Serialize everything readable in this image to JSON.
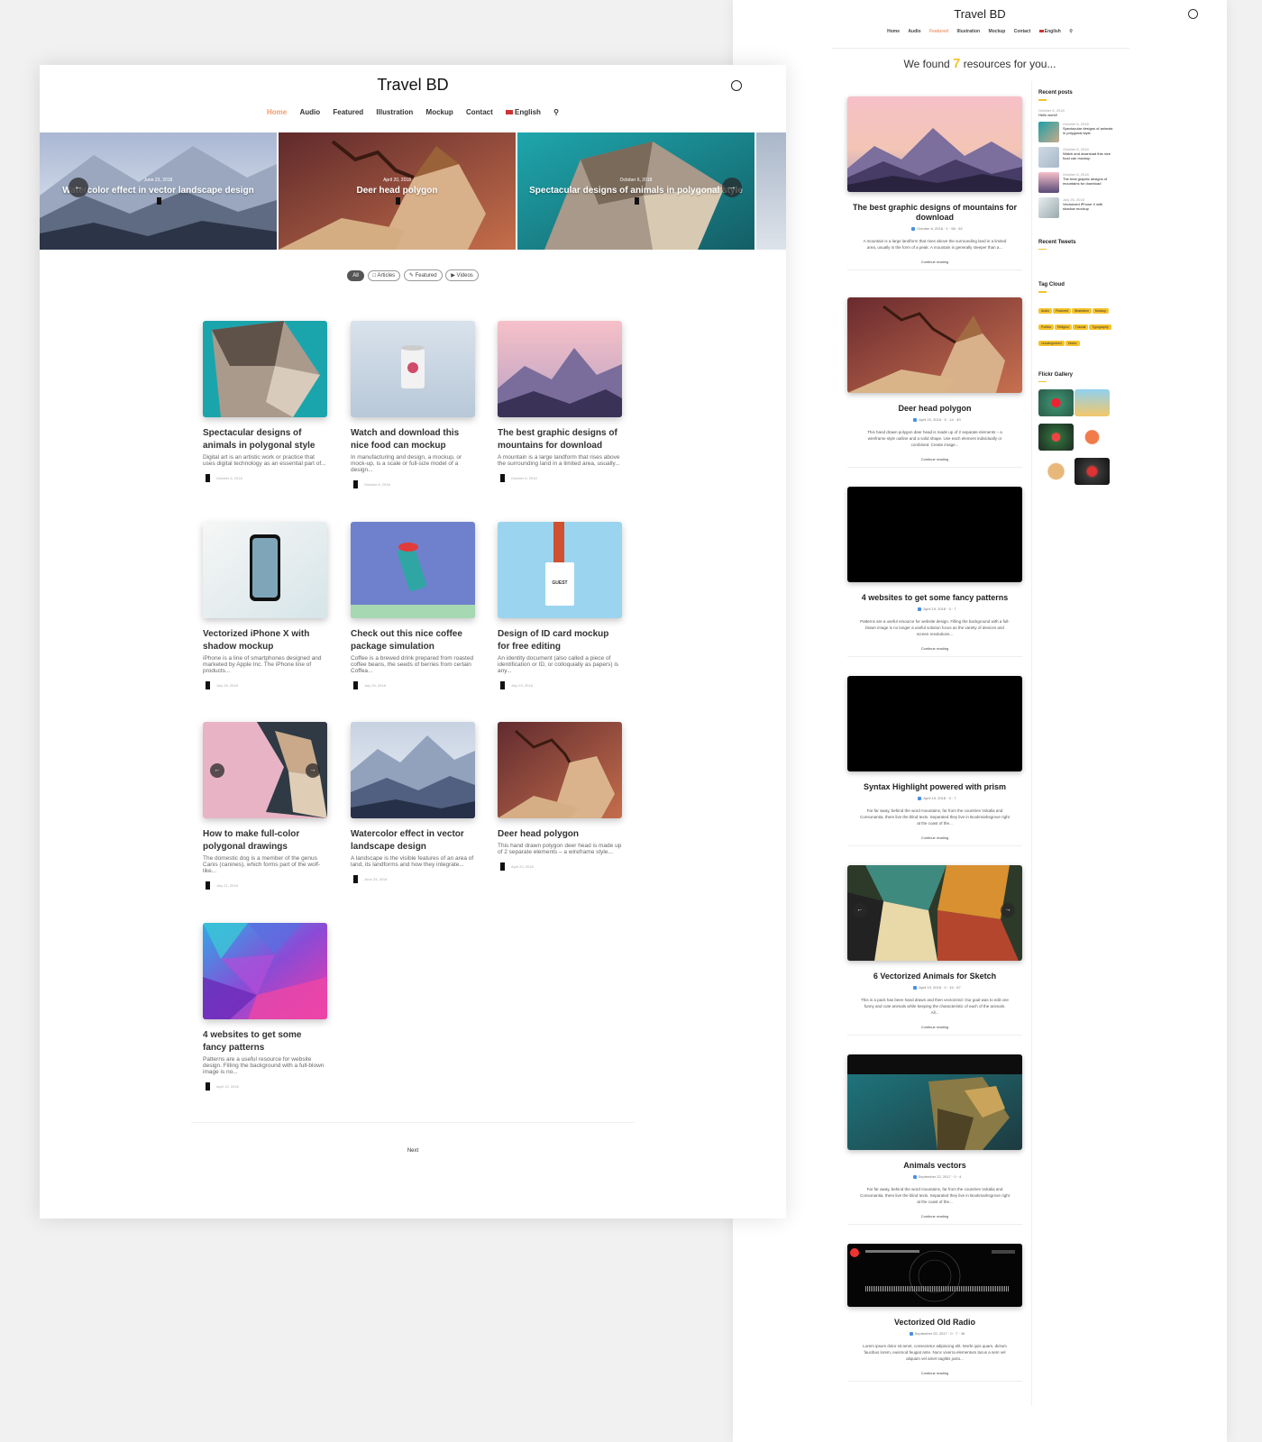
{
  "home": {
    "brand": "Travel BD",
    "nav": [
      "Home",
      "Audio",
      "Featured",
      "Illustration",
      "Mockup",
      "Contact",
      "English"
    ],
    "slides": [
      {
        "date": "June 23, 2018",
        "title": "Watercolor effect in vector landscape design"
      },
      {
        "date": "April 20, 2018",
        "title": "Deer head polygon"
      },
      {
        "date": "October 6, 2018",
        "title": "Spectacular designs of animals in polygonal style"
      }
    ],
    "filters": [
      "All",
      "Articles",
      "Featured",
      "Videos"
    ],
    "posts": [
      {
        "title": "Spectacular designs of animals in polygonal style",
        "excerpt": "Digital art is an artistic work or practice that uses digital technology as an essential part of...",
        "date": "October 6, 2018"
      },
      {
        "title": "Watch and download this nice food can mockup",
        "excerpt": "In manufacturing and design, a mockup, or mock-up, is a scale or full-size model of a design...",
        "date": "October 6, 2018"
      },
      {
        "title": "The best graphic designs of mountains for download",
        "excerpt": "A mountain is a large landform that rises above the surrounding land in a limited area, usually...",
        "date": "October 6, 2018"
      },
      {
        "title": "Vectorized iPhone X with shadow mockup",
        "excerpt": "iPhone is a line of smartphones designed and marketed by Apple Inc. The iPhone line of products...",
        "date": "July 26, 2018"
      },
      {
        "title": "Check out this nice coffee package simulation",
        "excerpt": "Coffee is a brewed drink prepared from roasted coffee beans, the seeds of berries from certain Coffea...",
        "date": "July 26, 2018"
      },
      {
        "title": "Design of ID card mockup for free editing",
        "excerpt": "An identity document (also called a piece of identification or ID, or colloquially as papers) is any...",
        "date": "July 23, 2018"
      },
      {
        "title": "How to make full-color polygonal drawings",
        "excerpt": "The domestic dog is a member of the genus Canis (canines), which forms part of the wolf-like...",
        "date": "July 21, 2018"
      },
      {
        "title": "Watercolor effect in vector landscape design",
        "excerpt": "A landscape is the visible features of an area of land, its landforms and how they integrate...",
        "date": "June 23, 2018"
      },
      {
        "title": "Deer head polygon",
        "excerpt": "This hand drawn polygon deer head is made up of 2 separate elements – a wireframe style...",
        "date": "April 20, 2018"
      },
      {
        "title": "4 websites to get some fancy patterns",
        "excerpt": "Patterns are a useful resource for website design. Filling the background with a full-blown image is no...",
        "date": "April 19, 2018"
      }
    ],
    "pagination_next": "Next",
    "badge_text": "GUEST"
  },
  "featured": {
    "brand": "Travel BD",
    "nav": [
      "Home",
      "Audio",
      "Featured",
      "Illustration",
      "Mockup",
      "Contact",
      "English"
    ],
    "found": {
      "prefix": "We found",
      "count": "7",
      "suffix": "resources for you..."
    },
    "posts": [
      {
        "title": "The best graphic designs of mountains for download",
        "meta": "October 6, 2018 · 1 · 98 · 62",
        "excerpt": "A mountain is a large landform that rises above the surrounding land in a limited area, usually in the form of a peak. A mountain is generally steeper than a...",
        "more": "Continue reading"
      },
      {
        "title": "Deer head polygon",
        "meta": "April 20, 2018 · 5 · 14 · 40",
        "excerpt": "This hand drawn polygon deer head is made up of 2 separate elements – a wireframe style outline and a solid shape. Use each element individually or combined. Create image...",
        "more": "Continue reading"
      },
      {
        "title": "4 websites to get some fancy patterns",
        "meta": "April 19, 2018 · 0 · 7",
        "excerpt": "Patterns are a useful resource for website design. Filling the background with a full-blown image is no longer a useful solution focus as the variety of devices and screen resolutions...",
        "more": "Continue reading"
      },
      {
        "title": "Syntax Highlight powered with prism",
        "meta": "April 19, 2018 · 0 · 7",
        "excerpt": "Far far away, behind the word mountains, far from the countries Vokalia and Consonantia, there live the blind texts. Separated they live in Bookmarksgrove right at the coast of the...",
        "more": "Continue reading"
      },
      {
        "title": "6 Vectorized Animals for Sketch",
        "meta": "April 19, 2018 · 0 · 15 · 67",
        "excerpt": "This is a pack has been hand drawn and then vectorized. Our goal was to edit one funny and cute animals while keeping the characteristic of each of the animals. All...",
        "more": "Continue reading"
      },
      {
        "title": "Animals vectors",
        "meta": "September 22, 2017 · 0 · 4",
        "excerpt": "Far far away, behind the word mountains, far from the countries Vokalia and Consonantia, there live the blind texts. Separated they live in Bookmarksgrove right at the coast of the...",
        "more": "Continue reading"
      },
      {
        "title": "Vectorized Old Radio",
        "meta": "September 20, 2017 · 0 · 7 · 36",
        "excerpt": "Lorem ipsum dolor sit amet, consectetur adipiscing elit. Morbi quis quam, dictum faucibus lorem, euismod feugiat ante. Nunc viverra elementum lacus a sem vel aliquam vel amet sagittis justo...",
        "more": "Continue reading"
      }
    ],
    "sidebar": {
      "recent_posts_title": "Recent posts",
      "first_post": {
        "date": "October 6, 2018",
        "title": "Hello world!"
      },
      "recent_posts": [
        {
          "date": "October 6, 2018",
          "title": "Spectacular designs of animals in polygonal style"
        },
        {
          "date": "October 6, 2018",
          "title": "Watch and download this nice food can mockup"
        },
        {
          "date": "October 6, 2018",
          "title": "The best graphic designs of mountains for download"
        },
        {
          "date": "July 26, 2018",
          "title": "Vectorized iPhone X with shadow mockup"
        }
      ],
      "recent_tweets_title": "Recent Tweets",
      "tag_cloud_title": "Tag Cloud",
      "tags": [
        "Audio",
        "Featured",
        "Illustration",
        "Mockup",
        "Politics",
        "Religion",
        "Tutorial",
        "Typography",
        "Uncategorized",
        "Vector"
      ],
      "flickr_title": "Flickr Gallery"
    }
  },
  "colors": {
    "accent": "#f09b6f",
    "highlight": "#f6c32b"
  }
}
